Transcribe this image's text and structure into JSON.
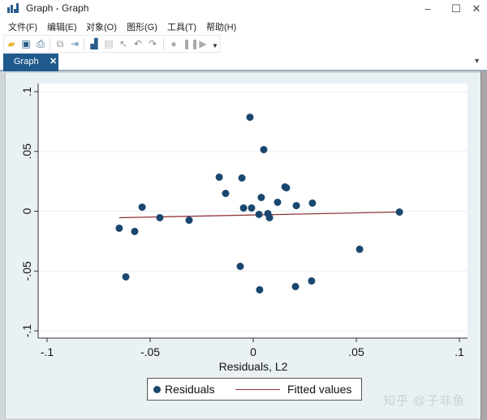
{
  "window": {
    "title": "Graph - Graph",
    "controls": {
      "minimize": "–",
      "maximize": "☐",
      "close": "✕"
    }
  },
  "menu": [
    "文件(F)",
    "编辑(E)",
    "对象(O)",
    "图形(G)",
    "工具(T)",
    "帮助(H)"
  ],
  "toolbar": {
    "icons": [
      "open-folder-icon",
      "save-icon",
      "print-icon",
      "copy-icon",
      "rename-icon",
      "graph-editor-icon",
      "properties-icon",
      "pointer-icon",
      "undo-icon",
      "redo-icon",
      "record-icon",
      "pause-icon",
      "play-icon",
      "dropdown-icon"
    ]
  },
  "tabs": [
    {
      "label": "Graph",
      "close": "✕"
    }
  ],
  "watermark": "知乎 @子非鱼",
  "colors": {
    "marker": "#1a476f",
    "fit_line": "#90353b",
    "outer_bg": "#eaf1f4",
    "plot_bg": "#ffffff",
    "accent": "#1e5b8c"
  },
  "chart_data": {
    "type": "scatter",
    "title": "",
    "xlabel": "Residuals, L2",
    "ylabel": "",
    "xlim": [
      -0.1,
      0.1
    ],
    "ylim": [
      -0.1,
      0.1
    ],
    "x_ticks": [
      -0.1,
      -0.05,
      0,
      0.05,
      0.1
    ],
    "x_tick_labels": [
      "-.1",
      "-.05",
      "0",
      ".05",
      ".1"
    ],
    "y_ticks": [
      -0.1,
      -0.05,
      0,
      0.05,
      0.1
    ],
    "y_tick_labels": [
      "-.1",
      "-.05",
      "0",
      ".05",
      ".1"
    ],
    "grid": "horizontal",
    "legend_position": "bottom",
    "series": [
      {
        "name": "Residuals",
        "type": "scatter",
        "points": [
          [
            -0.0016,
            0.0786
          ],
          [
            0.0051,
            0.0515
          ],
          [
            -0.0165,
            0.0285
          ],
          [
            -0.0055,
            0.0278
          ],
          [
            -0.0134,
            0.0149
          ],
          [
            0.0154,
            0.0203
          ],
          [
            0.0161,
            0.0196
          ],
          [
            0.0039,
            0.0115
          ],
          [
            0.0118,
            0.0075
          ],
          [
            0.0287,
            0.0068
          ],
          [
            0.0209,
            0.0047
          ],
          [
            -0.0047,
            0.0027
          ],
          [
            -0.0008,
            0.0027
          ],
          [
            -0.0539,
            0.0034
          ],
          [
            0.0028,
            -0.0027
          ],
          [
            0.0071,
            -0.002
          ],
          [
            0.0079,
            -0.0054
          ],
          [
            -0.0453,
            -0.0054
          ],
          [
            -0.0311,
            -0.0075
          ],
          [
            -0.065,
            -0.0142
          ],
          [
            -0.0575,
            -0.0169
          ],
          [
            0.0709,
            -0.0007
          ],
          [
            0.0516,
            -0.0318
          ],
          [
            -0.0063,
            -0.0461
          ],
          [
            -0.0618,
            -0.0549
          ],
          [
            0.0031,
            -0.0657
          ],
          [
            0.0205,
            -0.063
          ],
          [
            0.0283,
            -0.0583
          ]
        ]
      },
      {
        "name": "Fitted values",
        "type": "line",
        "points": [
          [
            -0.065,
            -0.0054
          ],
          [
            0.0709,
            -0.0007
          ]
        ]
      }
    ]
  }
}
